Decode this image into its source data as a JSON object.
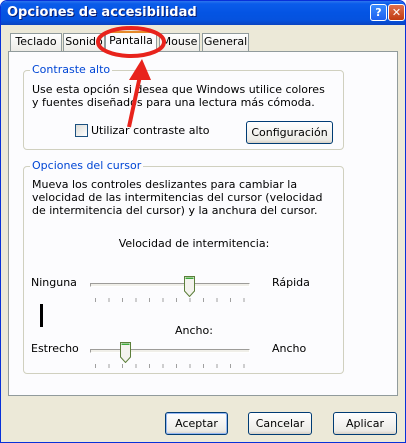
{
  "window": {
    "title": "Opciones de accesibilidad"
  },
  "titlebar": {
    "help_glyph": "?",
    "close_glyph": "✕"
  },
  "tabs": [
    {
      "label": "Teclado"
    },
    {
      "label": "Sonido"
    },
    {
      "label": "Pantalla",
      "active": true
    },
    {
      "label": "Mouse"
    },
    {
      "label": "General"
    }
  ],
  "contrast": {
    "legend": "Contraste alto",
    "description": "Use esta opción si desea que Windows utilice colores y fuentes diseñados para una lectura más cómoda.",
    "checkbox_label": "Utilizar contraste alto",
    "checkbox_checked": false,
    "settings_button": "Configuración"
  },
  "cursor": {
    "legend": "Opciones del cursor",
    "description": "Mueva los controles deslizantes para cambiar la velocidad de las intermitencias del cursor (velocidad de intermitencia del cursor) y la anchura del cursor.",
    "blink": {
      "label": "Velocidad de intermitencia:",
      "min_label": "Ninguna",
      "max_label": "Rápida",
      "position": 0.64
    },
    "width": {
      "label": "Ancho:",
      "min_label": "Estrecho",
      "max_label": "Ancho",
      "position": 0.2
    }
  },
  "annotation": {
    "color": "#e8231c"
  },
  "buttons": {
    "ok": "Aceptar",
    "cancel": "Cancelar",
    "apply": "Aplicar"
  }
}
